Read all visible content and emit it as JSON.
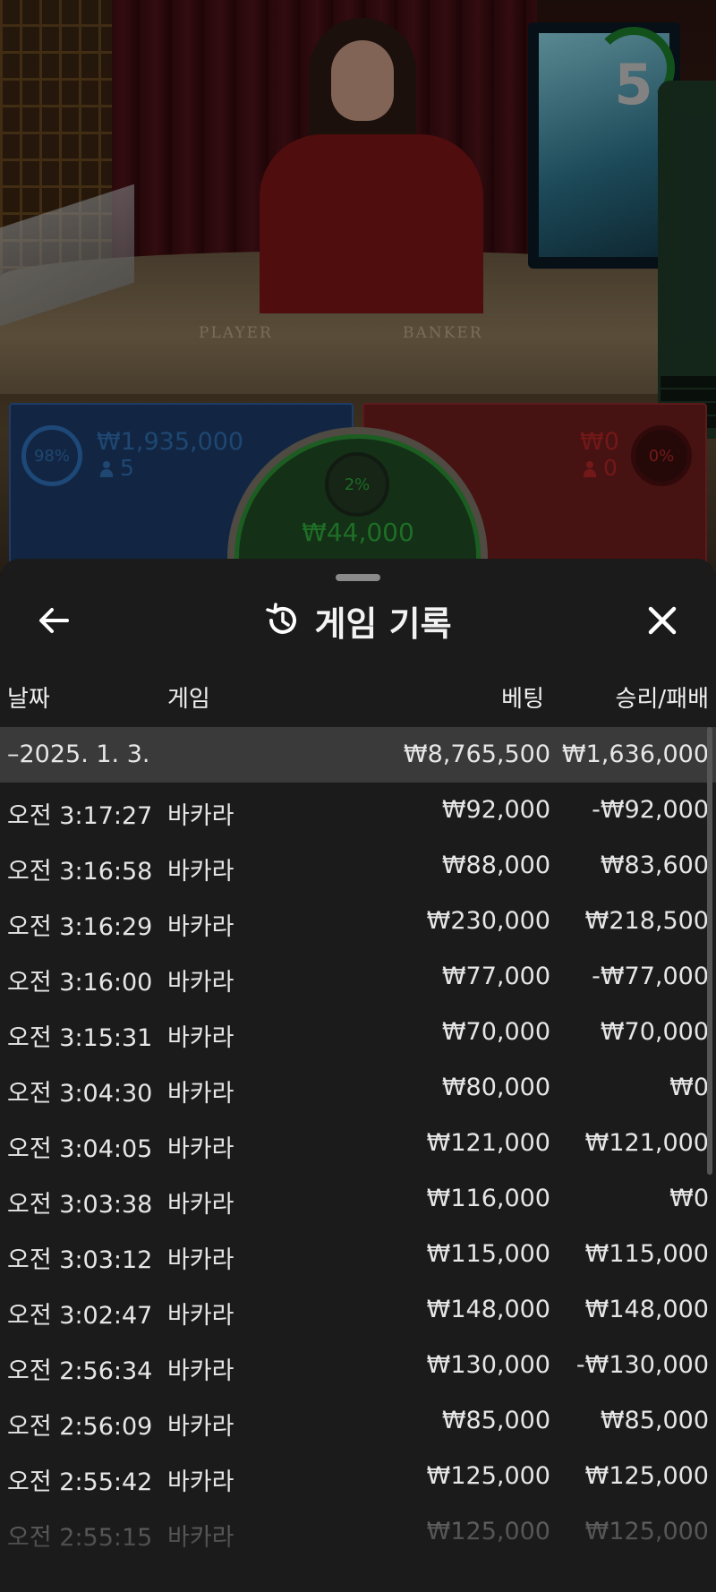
{
  "video": {
    "countdown": "5",
    "felt_player": "PLAYER",
    "felt_banker": "BANKER",
    "player": {
      "percent": "98%",
      "amount": "₩1,935,000",
      "players": "5"
    },
    "banker": {
      "percent": "0%",
      "amount": "₩0",
      "players": "0"
    },
    "tie": {
      "percent": "2%",
      "amount": "₩44,000"
    },
    "colors": {
      "player": "#2d6fb8",
      "banker": "#b02626",
      "tie": "#2fa93c"
    }
  },
  "history": {
    "title": "게임 기록",
    "icons": {
      "back": "arrow-left-icon",
      "title": "history-icon",
      "close": "close-icon"
    },
    "columns": {
      "date": "날짜",
      "game": "게임",
      "bet": "베팅",
      "result": "승리/패배"
    },
    "date_group": {
      "label": "–2025. 1. 3.",
      "total_bet": "₩8,765,500",
      "total_result": "₩1,636,000"
    },
    "rows": [
      {
        "time": "오전 3:17:27",
        "game": "바카라",
        "bet": "₩92,000",
        "result": "-₩92,000"
      },
      {
        "time": "오전 3:16:58",
        "game": "바카라",
        "bet": "₩88,000",
        "result": "₩83,600"
      },
      {
        "time": "오전 3:16:29",
        "game": "바카라",
        "bet": "₩230,000",
        "result": "₩218,500"
      },
      {
        "time": "오전 3:16:00",
        "game": "바카라",
        "bet": "₩77,000",
        "result": "-₩77,000"
      },
      {
        "time": "오전 3:15:31",
        "game": "바카라",
        "bet": "₩70,000",
        "result": "₩70,000"
      },
      {
        "time": "오전 3:04:30",
        "game": "바카라",
        "bet": "₩80,000",
        "result": "₩0"
      },
      {
        "time": "오전 3:04:05",
        "game": "바카라",
        "bet": "₩121,000",
        "result": "₩121,000"
      },
      {
        "time": "오전 3:03:38",
        "game": "바카라",
        "bet": "₩116,000",
        "result": "₩0"
      },
      {
        "time": "오전 3:03:12",
        "game": "바카라",
        "bet": "₩115,000",
        "result": "₩115,000"
      },
      {
        "time": "오전 3:02:47",
        "game": "바카라",
        "bet": "₩148,000",
        "result": "₩148,000"
      },
      {
        "time": "오전 2:56:34",
        "game": "바카라",
        "bet": "₩130,000",
        "result": "-₩130,000"
      },
      {
        "time": "오전 2:56:09",
        "game": "바카라",
        "bet": "₩85,000",
        "result": "₩85,000"
      },
      {
        "time": "오전 2:55:42",
        "game": "바카라",
        "bet": "₩125,000",
        "result": "₩125,000"
      },
      {
        "time": "오전 2:55:15",
        "game": "바카라",
        "bet": "₩125,000",
        "result": "₩125,000"
      }
    ]
  }
}
